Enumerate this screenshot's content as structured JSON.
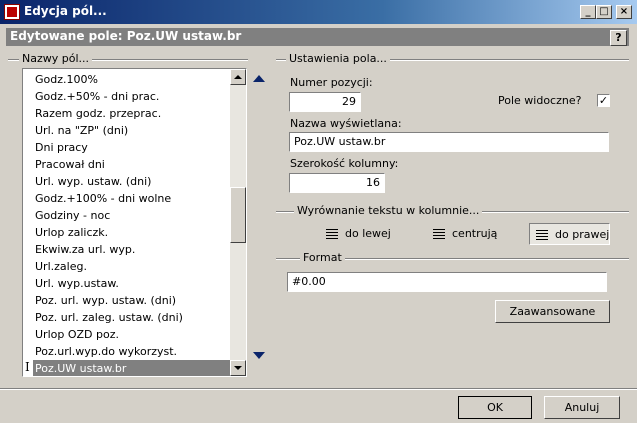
{
  "window": {
    "title": "Edycja pól...",
    "header": "Edytowane pole: Poz.UW ustaw.br",
    "help_label": "?",
    "min_label": "_",
    "max_label": "□",
    "close_label": "×"
  },
  "fields_panel": {
    "group_label": "Nazwy pól...",
    "items": [
      "Godz.100%",
      "Godz.+50% - dni prac.",
      "Razem godz. przeprac.",
      "Url. na \"ZP\" (dni)",
      "Dni pracy",
      "Pracował dni",
      "Url. wyp. ustaw. (dni)",
      "Godz.+100% - dni wolne",
      "Godziny - noc",
      "Urlop zaliczk.",
      "Ekwiw.za url. wyp.",
      "Url.zaleg.",
      "Url. wyp.ustaw.",
      "Poz. url. wyp. ustaw. (dni)",
      "Poz. url. zaleg. ustaw. (dni)",
      "Urlop OZD poz.",
      "Poz.url.wyp.do wykorzyst.",
      "Poz.UW ustaw.br"
    ],
    "selected_index": 17,
    "cursor_marker": "I"
  },
  "settings": {
    "group_label": "Ustawienia pola...",
    "position_label": "Numer pozycji:",
    "position_value": "29",
    "visible_label": "Pole widoczne?",
    "visible_checked": true,
    "checkmark": "✓",
    "display_name_label": "Nazwa wyświetlana:",
    "display_name_value": "Poz.UW ustaw.br",
    "width_label": "Szerokość kolumny:",
    "width_value": "16"
  },
  "alignment": {
    "group_label": "Wyrównanie tekstu w kolumnie...",
    "left_label": "do lewej",
    "center_label": "centrują",
    "right_label": "do prawej",
    "selected": "right"
  },
  "format": {
    "group_label": "Format",
    "value": "#0.00",
    "advanced_label": "Zaawansowane"
  },
  "footer": {
    "ok_label": "OK",
    "cancel_label": "Anuluj"
  }
}
